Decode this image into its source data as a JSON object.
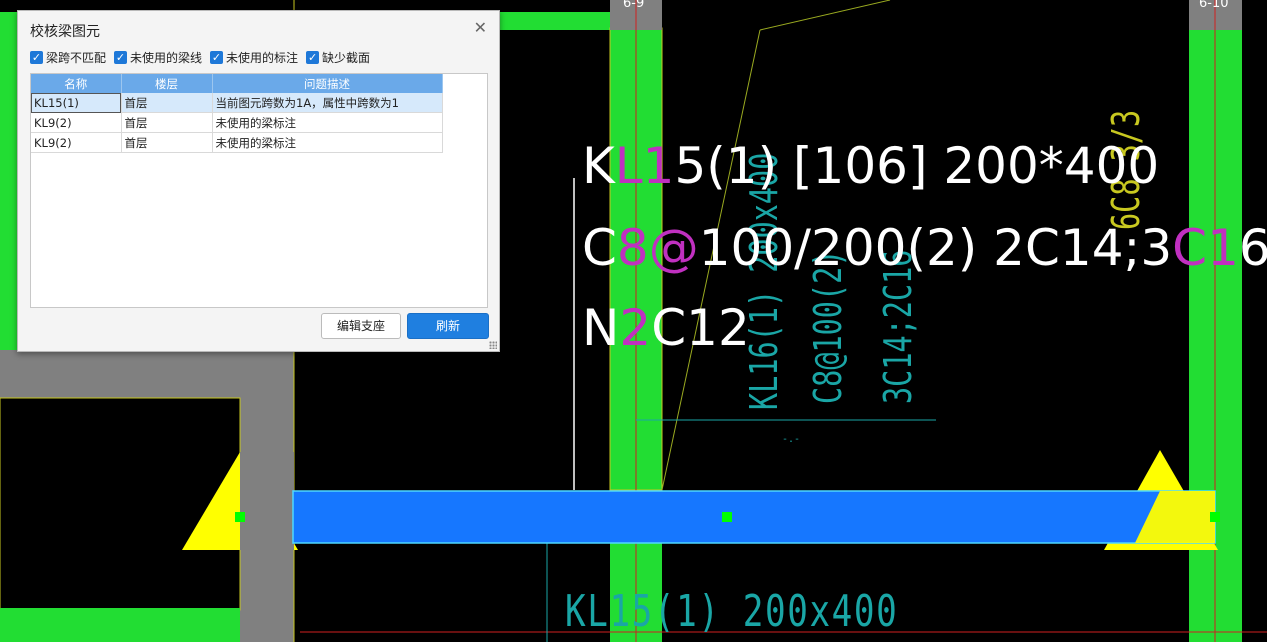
{
  "dialog": {
    "title": "校核梁图元",
    "filters": [
      {
        "label": "梁跨不匹配",
        "checked": true
      },
      {
        "label": "未使用的梁线",
        "checked": true
      },
      {
        "label": "未使用的标注",
        "checked": true
      },
      {
        "label": "缺少截面",
        "checked": true
      }
    ],
    "columns": [
      "名称",
      "楼层",
      "问题描述"
    ],
    "rows": [
      {
        "name": "KL15(1)",
        "floor": "首层",
        "desc": "当前图元跨数为1A，属性中跨数为1",
        "selected": true
      },
      {
        "name": "KL9(2)",
        "floor": "首层",
        "desc": "未使用的梁标注",
        "selected": false
      },
      {
        "name": "KL9(2)",
        "floor": "首层",
        "desc": "未使用的梁标注",
        "selected": false
      }
    ],
    "buttons": {
      "edit_support": "编辑支座",
      "refresh": "刷新"
    }
  },
  "cad": {
    "axis_labels": [
      "6-9",
      "6-10"
    ],
    "annotation_lines": [
      {
        "parts": [
          {
            "t": "K",
            "m": false
          },
          {
            "t": "L1",
            "m": true
          },
          {
            "t": "5(1) [106] 200*400",
            "m": false
          }
        ]
      },
      {
        "parts": [
          {
            "t": "C",
            "m": false
          },
          {
            "t": "8@",
            "m": true
          },
          {
            "t": "100/200(2) 2C14;3",
            "m": false
          },
          {
            "t": "C1",
            "m": true
          },
          {
            "t": "6",
            "m": false
          }
        ]
      },
      {
        "parts": [
          {
            "t": "N",
            "m": false
          },
          {
            "t": "2",
            "m": true
          },
          {
            "t": "C12",
            "m": false
          }
        ]
      }
    ],
    "bottom_label": "KL15(1)  200x400",
    "vertical_labels": [
      "KL16(1) 200x400",
      "C8@100(2)",
      "3C14;2C16"
    ],
    "vertical_yellow": "6C8 3/3",
    "colors": {
      "beam_selected": "#1677ff",
      "column_green": "#22dd33",
      "support_yellow": "#ffff00",
      "cad_cyan": "#1aa6a6",
      "annotation_magenta": "#c030c0"
    }
  }
}
